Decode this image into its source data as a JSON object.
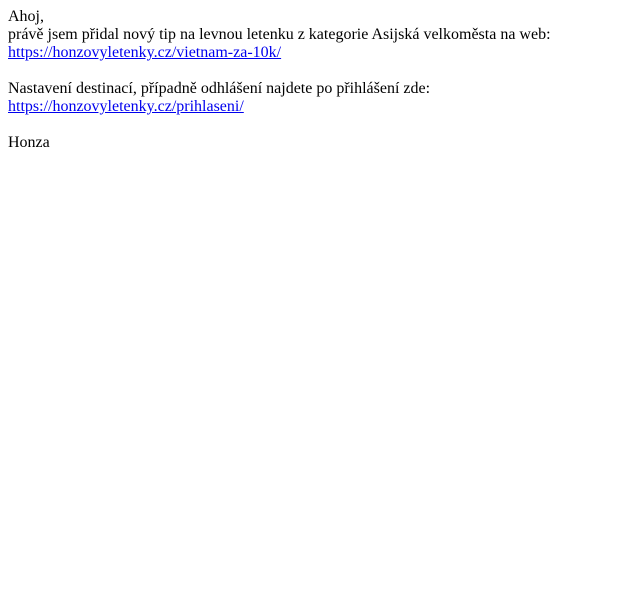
{
  "email": {
    "greeting": "Ahoj,",
    "intro": "právě jsem přidal nový tip na levnou letenku z kategorie Asijská velkoměsta na web:",
    "tip_link": "https://honzovyletenky.cz/vietnam-za-10k/",
    "settings_text": "Nastavení destinací, případně odhlášení najdete po přihlášení zde:",
    "login_link": "https://honzovyletenky.cz/prihlaseni/",
    "signature": "Honza"
  },
  "colors": {
    "text": "#000000",
    "link": "#0000ee",
    "background": "#ffffff"
  }
}
